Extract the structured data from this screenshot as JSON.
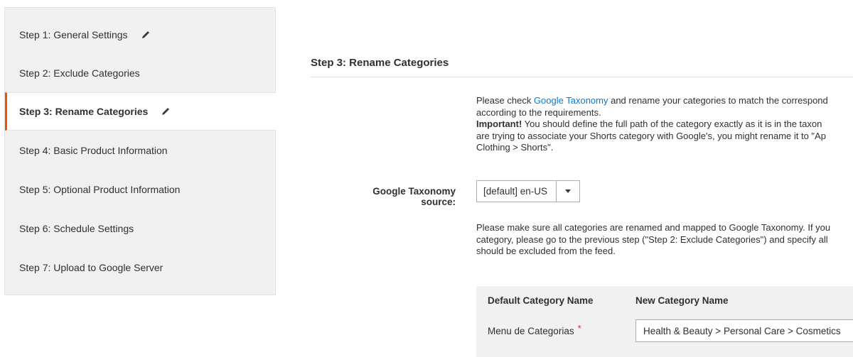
{
  "sidebar": {
    "items": [
      {
        "label": "Step 1: General Settings",
        "editable": true,
        "active": false
      },
      {
        "label": "Step 2: Exclude Categories",
        "editable": false,
        "active": false
      },
      {
        "label": "Step 3: Rename Categories",
        "editable": true,
        "active": true
      },
      {
        "label": "Step 4: Basic Product Information",
        "editable": false,
        "active": false
      },
      {
        "label": "Step 5: Optional Product Information",
        "editable": false,
        "active": false
      },
      {
        "label": "Step 6: Schedule Settings",
        "editable": false,
        "active": false
      },
      {
        "label": "Step 7: Upload to Google Server",
        "editable": false,
        "active": false
      }
    ]
  },
  "main": {
    "title": "Step 3: Rename Categories",
    "intro": {
      "line1_pre": "Please check ",
      "line1_link": "Google Taxonomy",
      "line1_post": " and rename your categories to match the correspond",
      "line2": "according to the requirements.",
      "line3_bold": "Important!",
      "line3_post": " You should define the full path of the category exactly as it is in the taxon",
      "line4": "are trying to associate your Shorts category with Google's, you might rename it to \"Ap",
      "line5": "Clothing > Shorts\"."
    },
    "taxonomy_source": {
      "label": "Google Taxonomy source:",
      "value": "[default] en-US"
    },
    "note": {
      "line1": "Please make sure all categories are renamed and mapped to Google Taxonomy. If you",
      "line2": "category, please go to the previous step (\"Step 2: Exclude Categories\") and specify all",
      "line3": "should be excluded from the feed."
    },
    "table": {
      "headers": [
        "Default Category Name",
        "New Category Name"
      ],
      "rows": [
        {
          "default_name": "Menu de Categorias",
          "required": "*",
          "new_name": "Health & Beauty > Personal Care > Cosmetics"
        }
      ]
    }
  },
  "colors": {
    "accent": "#eb5202",
    "link": "#007bdb",
    "required": "#e22626"
  }
}
